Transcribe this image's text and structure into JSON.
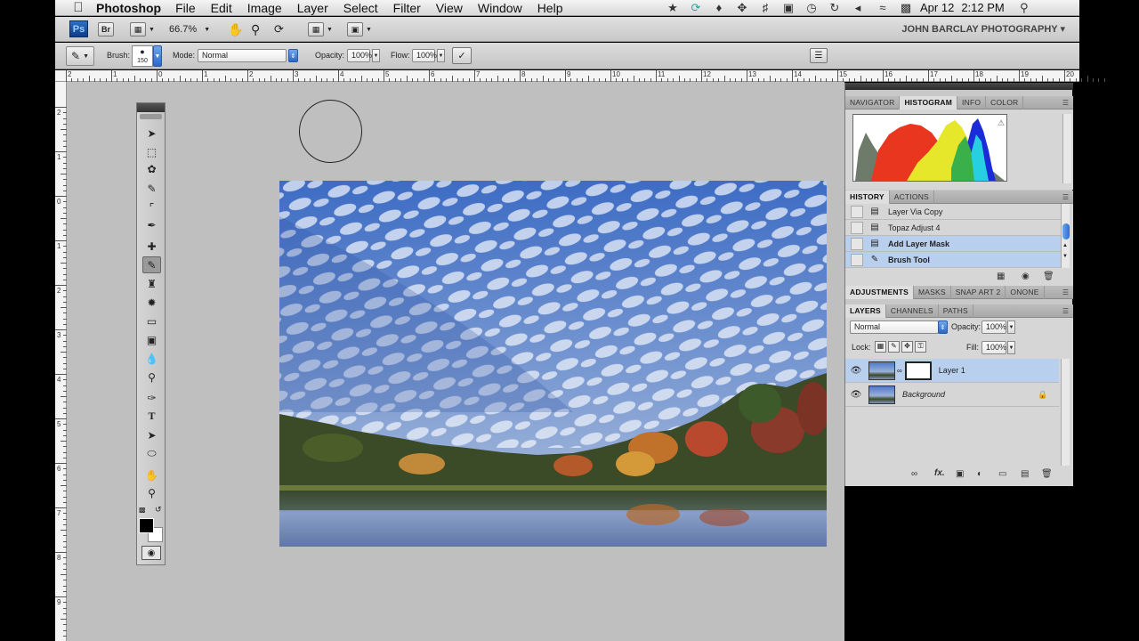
{
  "menubar": {
    "apple_icon": "apple-icon",
    "app_name": "Photoshop",
    "menus": [
      "File",
      "Edit",
      "Image",
      "Layer",
      "Select",
      "Filter",
      "View",
      "Window",
      "Help"
    ],
    "date": "Apr 12",
    "time": "2:12 PM"
  },
  "appbar": {
    "logo": "Ps",
    "bridge": "Br",
    "zoom": "66.7%",
    "workspace": "JOHN BARCLAY PHOTOGRAPHY ▾"
  },
  "options": {
    "brush_label": "Brush:",
    "brush_size": "150",
    "mode_label": "Mode:",
    "mode_value": "Normal",
    "opacity_label": "Opacity:",
    "opacity_value": "100%",
    "flow_label": "Flow:",
    "flow_value": "100%"
  },
  "ruler": {
    "top_numbers": [
      "2",
      "1",
      "0",
      "1",
      "2",
      "3",
      "4",
      "5",
      "6",
      "7",
      "8",
      "9",
      "10",
      "11",
      "12",
      "13",
      "14",
      "15",
      "16",
      "17",
      "18",
      "19",
      "20"
    ],
    "left_numbers": [
      "2",
      "1",
      "0",
      "1",
      "2",
      "3",
      "4",
      "5",
      "6",
      "7",
      "8",
      "9"
    ]
  },
  "panels": {
    "group1_tabs": [
      "NAVIGATOR",
      "HISTOGRAM",
      "INFO",
      "COLOR"
    ],
    "group1_active": "HISTOGRAM",
    "history_tabs": [
      "HISTORY",
      "ACTIONS"
    ],
    "history_items": [
      {
        "label": "Layer Via Copy",
        "selected": false
      },
      {
        "label": "Topaz Adjust 4",
        "selected": false
      },
      {
        "label": "Add Layer Mask",
        "selected": true
      },
      {
        "label": "Brush Tool",
        "selected": true
      }
    ],
    "adjust_tabs": [
      "ADJUSTMENTS",
      "MASKS",
      "SNAP ART 2",
      "ONONE"
    ],
    "layers_tabs": [
      "LAYERS",
      "CHANNELS",
      "PATHS"
    ],
    "blend_mode": "Normal",
    "opacity_label": "Opacity:",
    "opacity_value": "100%",
    "lock_label": "Lock:",
    "fill_label": "Fill:",
    "fill_value": "100%",
    "layers": [
      {
        "name": "Layer 1",
        "selected": true,
        "italic": false
      },
      {
        "name": "Background",
        "selected": false,
        "italic": true
      }
    ],
    "footer_fx": "fx."
  },
  "colors": {
    "selection": "#b8cfee",
    "canvas_bg": "#bfbfbf",
    "accent_blue": "#2b6cd0"
  }
}
